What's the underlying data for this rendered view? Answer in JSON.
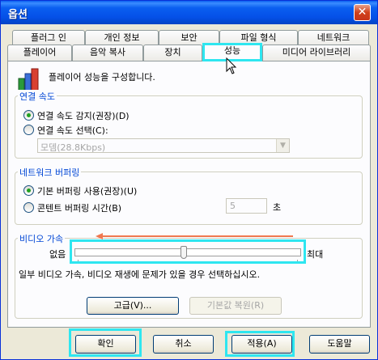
{
  "window": {
    "title": "옵션",
    "close_glyph": "✕"
  },
  "tabs_row1": [
    "플러그 인",
    "개인 정보",
    "보안",
    "파일 형식",
    "네트워크"
  ],
  "tabs_row2": [
    "플레이어",
    "음악 복사",
    "장치",
    "성능",
    "미디어 라이브러리"
  ],
  "active_tab": "성능",
  "header": {
    "icon": "performance-bars-icon",
    "text": "플레이어 성능을 구성합니다."
  },
  "connection": {
    "legend": "연결 속도",
    "detect_label": "연결 속도 감지(권장)(D)",
    "select_label": "연결 속도 선택(C):",
    "speed_value": "모뎀(28.8Kbps)"
  },
  "buffering": {
    "legend": "네트워크 버퍼링",
    "default_label": "기본 버퍼링 사용(권장)(U)",
    "custom_label": "콘텐트 버퍼링 시간(B)",
    "seconds_value": "5",
    "seconds_unit": "초"
  },
  "video": {
    "legend": "비디오 가속",
    "min_label": "없음",
    "max_label": "최대",
    "level": 0.48,
    "note": "일부 비디오 가속, 비디오 재생에 문제가 있을 경우 선택하십시오.",
    "advanced_button": "고급(V)...",
    "restore_button": "기본값 복원(R)"
  },
  "footer": {
    "ok": "확인",
    "cancel": "취소",
    "apply": "적용(A)",
    "help": "도움말"
  },
  "colors": {
    "highlight": "#2ee6f0",
    "arrow": "#f07850",
    "legend": "#0046d5"
  }
}
